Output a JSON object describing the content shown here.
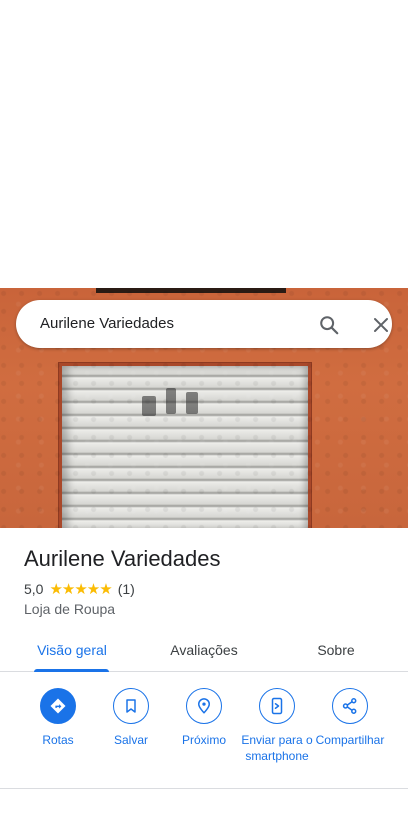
{
  "search": {
    "query": "Aurilene Variedades",
    "search_icon": "search-icon",
    "close_icon": "close-icon"
  },
  "place": {
    "name": "Aurilene Variedades",
    "rating": "5,0",
    "stars": "★★★★★",
    "review_count": "(1)",
    "category": "Loja de Roupa"
  },
  "tabs": [
    {
      "label": "Visão geral",
      "active": true
    },
    {
      "label": "Avaliações",
      "active": false
    },
    {
      "label": "Sobre",
      "active": false
    }
  ],
  "actions": [
    {
      "label": "Rotas",
      "icon": "directions-icon"
    },
    {
      "label": "Salvar",
      "icon": "bookmark-icon"
    },
    {
      "label": "Próximo",
      "icon": "nearby-icon"
    },
    {
      "label": "Enviar para o smartphone",
      "icon": "send-to-phone-icon"
    },
    {
      "label": "Compartilhar",
      "icon": "share-icon"
    }
  ],
  "colors": {
    "accent": "#1a73e8",
    "star": "#fbbc04",
    "text": "#202124",
    "muted": "#5f6368"
  }
}
